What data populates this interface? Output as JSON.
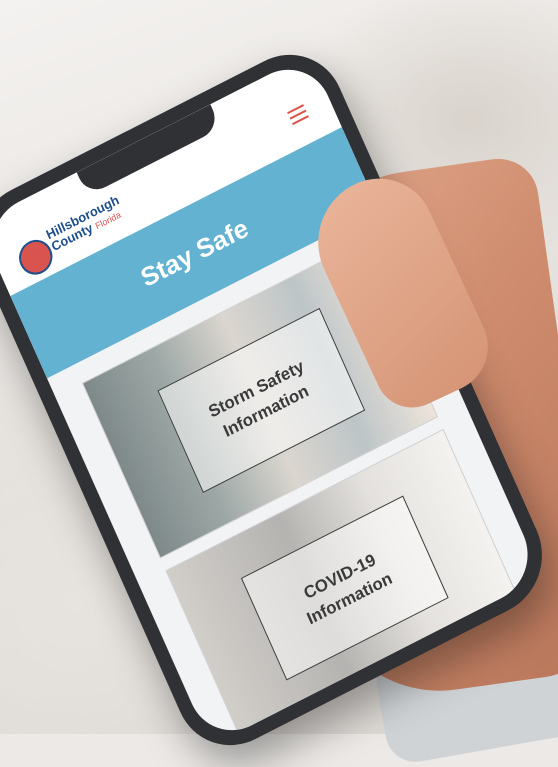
{
  "site": {
    "logo": {
      "line1": "Hillsborough",
      "line2": "County",
      "line3": "Florida"
    },
    "menu_icon": "hamburger-menu-icon"
  },
  "hero": {
    "title": "Stay Safe"
  },
  "cards": [
    {
      "title": "Storm Safety Information"
    },
    {
      "title": "COVID-19 Information"
    }
  ],
  "colors": {
    "hero_bg": "#63b2d2",
    "brand_blue": "#1d4f8c",
    "brand_red": "#d9534f",
    "phone_frame": "#2f3134"
  }
}
